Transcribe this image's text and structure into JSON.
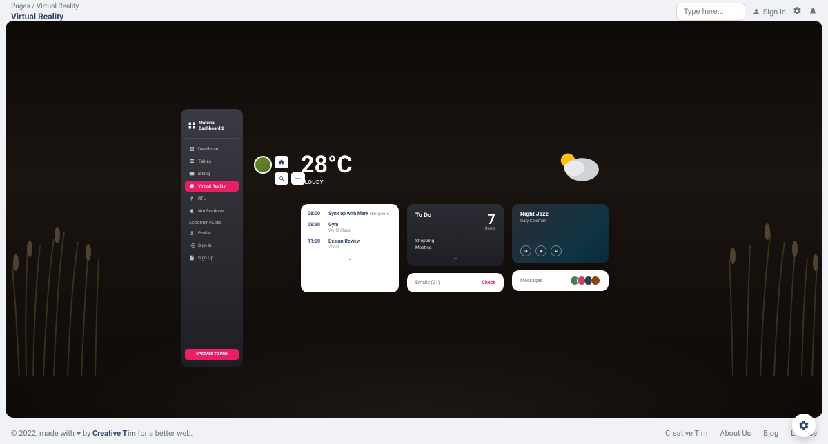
{
  "breadcrumb": {
    "root": "Pages",
    "current": "Virtual Reality"
  },
  "page_title": "Virtual Reality",
  "search": {
    "placeholder": "Type here..."
  },
  "topbar": {
    "signin": "Sign In"
  },
  "sidebar": {
    "brand": "Material Dashboard 2",
    "items": [
      {
        "label": "Dashboard"
      },
      {
        "label": "Tables"
      },
      {
        "label": "Billing"
      },
      {
        "label": "Virtual Reality"
      },
      {
        "label": "RTL"
      },
      {
        "label": "Notifications"
      }
    ],
    "section_label": "ACCOUNT PAGES",
    "account_items": [
      {
        "label": "Profile"
      },
      {
        "label": "Sign In"
      },
      {
        "label": "Sign Up"
      }
    ],
    "upgrade": "UPGRADE TO PRO"
  },
  "weather": {
    "temp": "28°C",
    "desc": "CLOUDY"
  },
  "schedule": {
    "rows": [
      {
        "time": "08:00",
        "title": "Synk up with Mark",
        "title_muted": "Hangouts",
        "sub": ""
      },
      {
        "time": "09:30",
        "title": "Gym",
        "sub": "World Class"
      },
      {
        "time": "11:00",
        "title": "Design Review",
        "sub": "Zoom"
      }
    ]
  },
  "todo": {
    "title": "To Do",
    "count": "7",
    "items_label": "items",
    "list": [
      "Shopping",
      "Meeting"
    ]
  },
  "emails": {
    "label": "Emails (21)",
    "action": "Check"
  },
  "music": {
    "title": "Night Jazz",
    "artist": "Gary Coleman"
  },
  "messages": {
    "label": "Messages"
  },
  "footer": {
    "prefix": "© 2022, made with ",
    "by": " by ",
    "author": "Creative Tim",
    "suffix": " for a better web.",
    "links": [
      "Creative Tim",
      "About Us",
      "Blog",
      "License"
    ]
  }
}
